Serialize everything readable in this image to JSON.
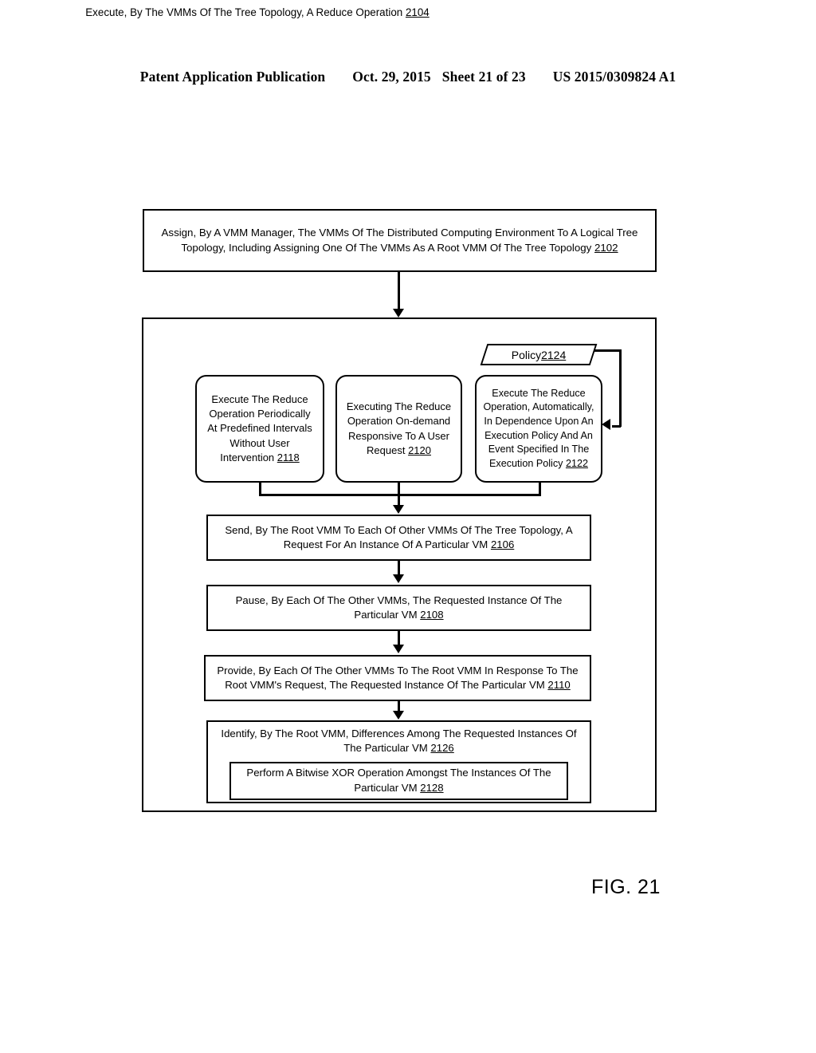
{
  "header": {
    "publication": "Patent Application Publication",
    "date": "Oct. 29, 2015",
    "sheet": "Sheet 21 of 23",
    "patent_number": "US 2015/0309824 A1"
  },
  "figure": {
    "label": "FIG. 21",
    "steps": {
      "s2102": {
        "text": "Assign, By A VMM Manager, The VMMs Of The Distributed Computing Environment To A Logical Tree Topology, Including Assigning One Of The VMMs As A Root VMM Of The Tree Topology ",
        "ref": "2102"
      },
      "s2104": {
        "text": "Execute, By The VMMs Of The Tree Topology, A Reduce Operation  ",
        "ref": "2104"
      },
      "s2124": {
        "text": "Policy ",
        "ref": "2124"
      },
      "s2118": {
        "text": "Execute The Reduce Operation Periodically At Predefined Intervals Without User Intervention ",
        "ref": "2118"
      },
      "s2120": {
        "text": "Executing The Reduce Operation On-demand Responsive To A User Request ",
        "ref": "2120"
      },
      "s2122": {
        "text": "Execute The Reduce Operation, Automatically, In Dependence Upon An Execution Policy And An Event Specified In The Execution Policy ",
        "ref": "2122"
      },
      "s2106": {
        "text": "Send, By The Root VMM To Each Of Other VMMs Of The Tree Topology, A Request For An Instance Of A Particular VM ",
        "ref": "2106"
      },
      "s2108": {
        "text": "Pause, By Each Of The Other VMMs, The Requested Instance Of The Particular VM ",
        "ref": "2108"
      },
      "s2110": {
        "text": "Provide, By Each Of The Other VMMs To The Root VMM In Response To The Root VMM's Request, The Requested Instance Of The Particular VM ",
        "ref": "2110"
      },
      "s2126": {
        "text": "Identify, By The Root VMM, Differences Among The Requested Instances Of The Particular VM ",
        "ref": "2126"
      },
      "s2128": {
        "text": "Perform A Bitwise XOR Operation Amongst The Instances Of The Particular VM ",
        "ref": "2128"
      }
    },
    "colors": {
      "stroke": "#000000",
      "background": "#ffffff"
    }
  }
}
